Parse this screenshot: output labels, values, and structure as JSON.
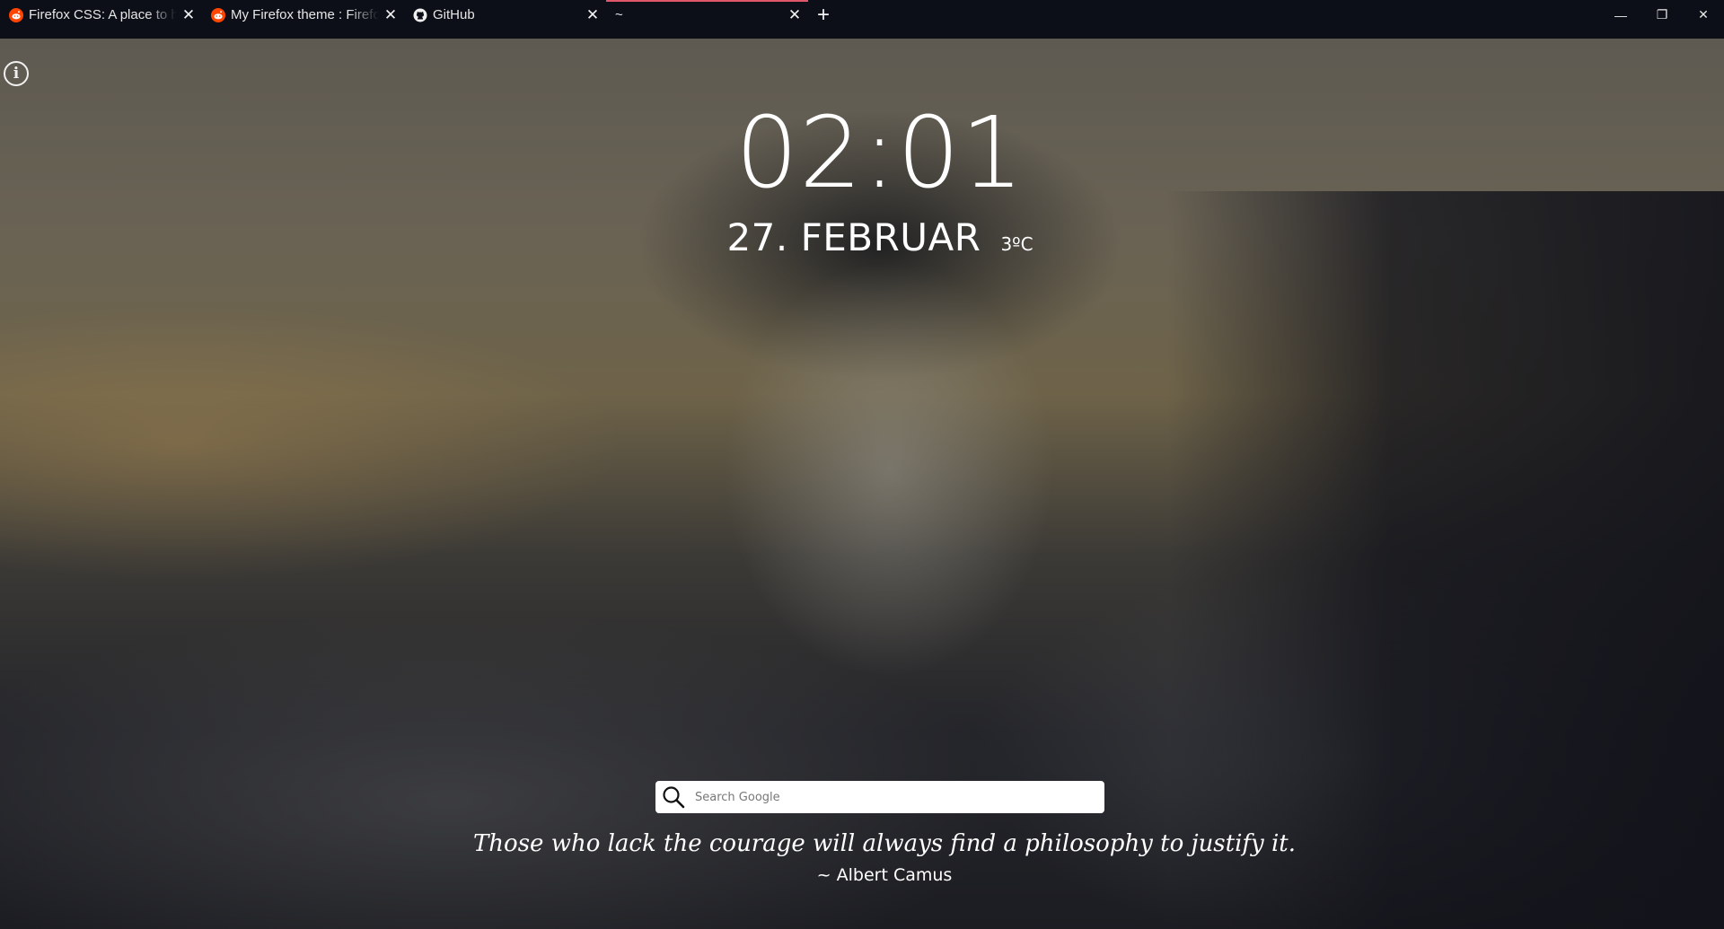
{
  "browser": {
    "tabs": [
      {
        "title": "Firefox CSS: A place to help",
        "favicon": "reddit-icon",
        "active": false
      },
      {
        "title": "My Firefox theme : FirefoxCSS",
        "favicon": "reddit-icon",
        "active": false
      },
      {
        "title": "GitHub",
        "favicon": "github-icon",
        "active": false
      },
      {
        "title": "~",
        "favicon": "none",
        "active": true
      }
    ],
    "new_tab_label": "+",
    "window_controls": {
      "minimize": "—",
      "restore": "❐",
      "close": "✕"
    },
    "accent_color": "#e0566b"
  },
  "startpage": {
    "info_label": "i",
    "time": "02:01",
    "date": "27. FEBRUAR",
    "temperature": "3ºC",
    "search": {
      "placeholder": "Search Google",
      "value": ""
    },
    "quote": {
      "text": "Those who lack the courage will always find a philosophy to justify it.",
      "author": "~ Albert Camus"
    }
  }
}
